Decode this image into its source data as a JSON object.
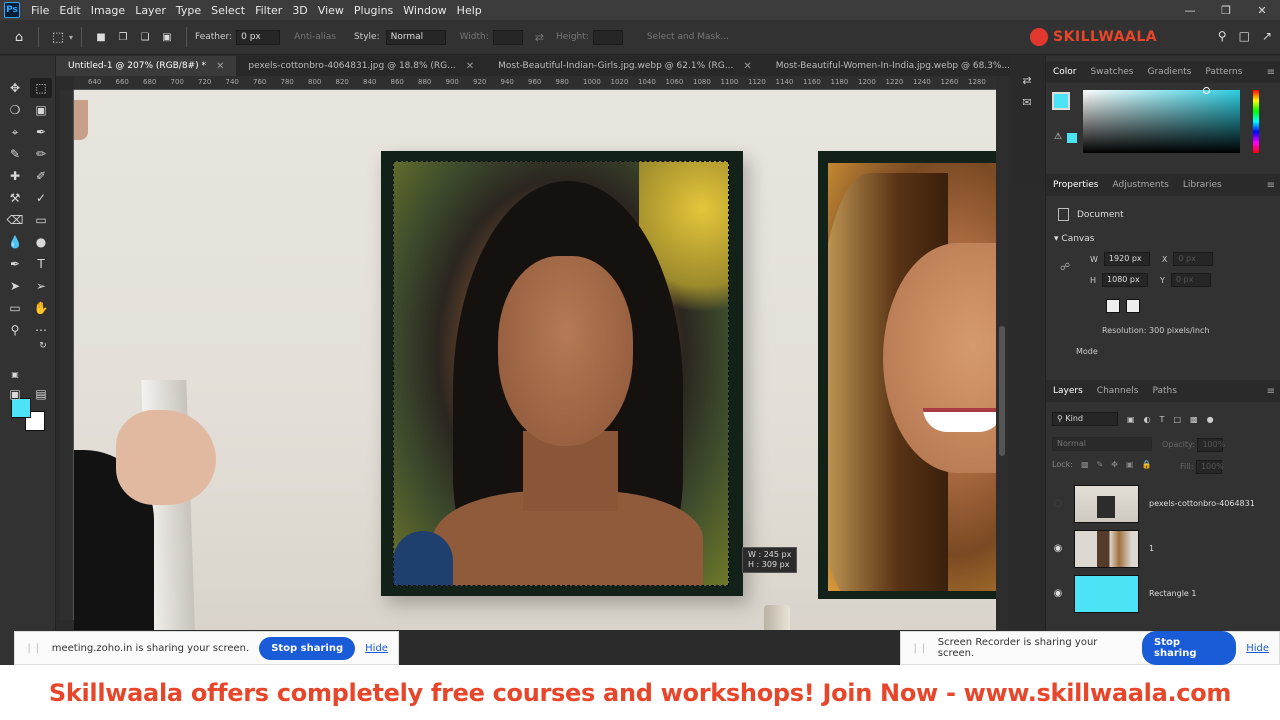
{
  "app": {
    "logo_text": "Ps",
    "menu": [
      "File",
      "Edit",
      "Image",
      "Layer",
      "Type",
      "Select",
      "Filter",
      "3D",
      "View",
      "Plugins",
      "Window",
      "Help"
    ]
  },
  "options": {
    "feather_label": "Feather:",
    "feather_value": "0 px",
    "antialias_label": "Anti-alias",
    "style_label": "Style:",
    "style_value": "Normal",
    "width_label": "Width:",
    "height_label": "Height:",
    "select_mask_label": "Select and Mask...",
    "brand_text": "SKILLWAALA"
  },
  "tabs": [
    {
      "label": "Untitled-1 @ 207% (RGB/8#) *"
    },
    {
      "label": "pexels-cottonbro-4064831.jpg @ 18.8% (RG..."
    },
    {
      "label": "Most-Beautiful-Indian-Girls.jpg.webp @ 62.1% (RG..."
    },
    {
      "label": "Most-Beautiful-Women-In-India.jpg.webp @ 68.3%..."
    }
  ],
  "ruler_ticks": [
    "640",
    "660",
    "680",
    "700",
    "720",
    "740",
    "760",
    "780",
    "800",
    "820",
    "840",
    "860",
    "880",
    "900",
    "920",
    "940",
    "960",
    "980",
    "1000",
    "1020",
    "1040",
    "1060",
    "1080",
    "1100",
    "1120",
    "1140",
    "1160",
    "1180",
    "1200",
    "1220",
    "1240",
    "1260",
    "1280"
  ],
  "canvas": {
    "dim_w": "W : 245 px",
    "dim_h": "H : 309 px"
  },
  "colors": {
    "foreground": "#4be3f5",
    "background": "#ffffff",
    "accent": "#e8462a"
  },
  "color_panel": {
    "tabs": [
      "Color",
      "Swatches",
      "Gradients",
      "Patterns"
    ]
  },
  "properties": {
    "tabs": [
      "Properties",
      "Adjustments",
      "Libraries"
    ],
    "document_label": "Document",
    "canvas_label": "Canvas",
    "w_label": "W",
    "w_value": "1920 px",
    "h_label": "H",
    "h_value": "1080 px",
    "x_label": "X",
    "x_value": "0 px",
    "y_label": "Y",
    "y_value": "0 px",
    "resolution": "Resolution: 300 pixels/inch",
    "mode_label": "Mode"
  },
  "layers": {
    "tabs": [
      "Layers",
      "Channels",
      "Paths"
    ],
    "kind_label": "Kind",
    "blend_mode": "Normal",
    "opacity_label": "Opacity:",
    "opacity_value": "100%",
    "lock_label": "Lock:",
    "fill_label": "Fill:",
    "fill_value": "100%",
    "items": [
      {
        "name": "pexels-cottonbro-4064831",
        "visible": false
      },
      {
        "name": "1",
        "visible": true
      },
      {
        "name": "Rectangle 1",
        "visible": true
      }
    ]
  },
  "share_bars": [
    {
      "message": "meeting.zoho.in is sharing your screen.",
      "stop_label": "Stop sharing",
      "hide_label": "Hide"
    },
    {
      "message": "Screen Recorder is sharing your screen.",
      "stop_label": "Stop sharing",
      "hide_label": "Hide"
    }
  ],
  "banner": {
    "text": "Skillwaala offers completely free courses and workshops! Join Now  - www.skillwaala.com"
  }
}
